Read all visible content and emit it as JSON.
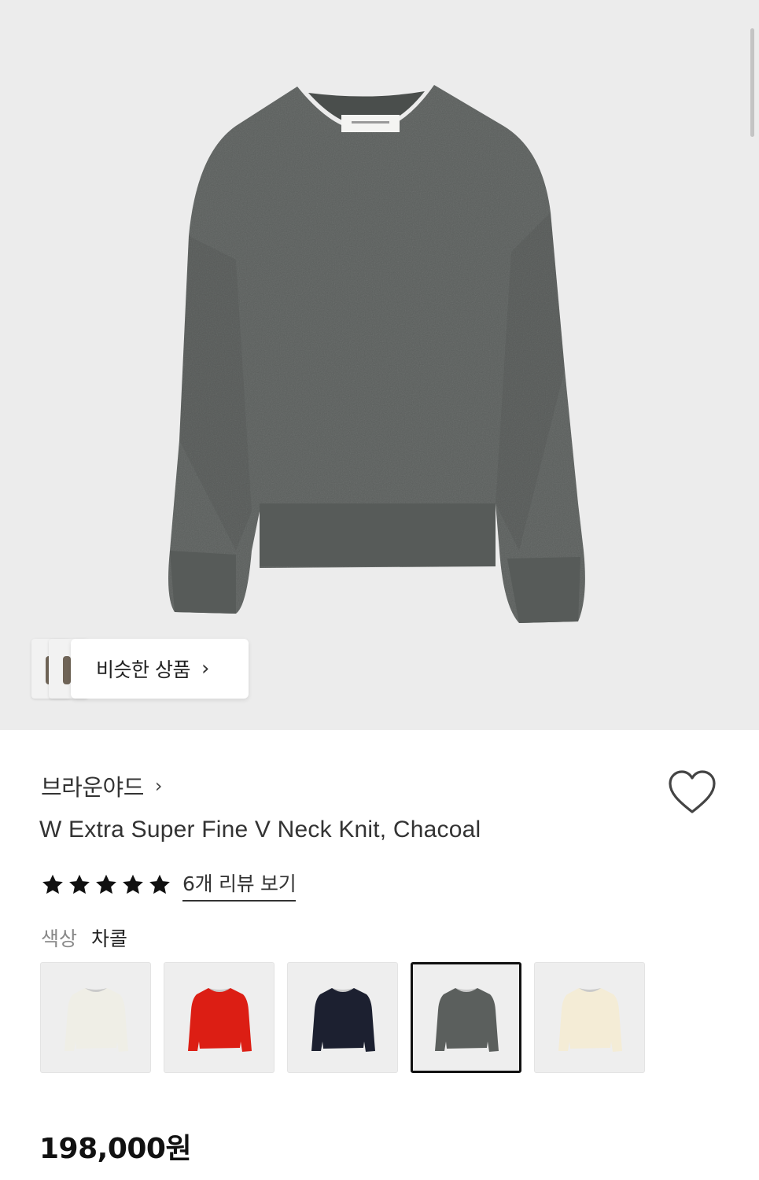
{
  "similar_products": {
    "label": "비슷한 상품",
    "chevron": "›"
  },
  "product": {
    "brand": "브라운야드",
    "brand_chevron": "›",
    "title": "W Extra Super Fine V Neck Knit, Chacoal",
    "rating_stars": 5,
    "review_link": "6개 리뷰 보기",
    "color_label": "색상",
    "color_value": "차콜",
    "price": "198,000원"
  },
  "color_options": [
    {
      "name": "ivory",
      "color": "#efeee6",
      "selected": false
    },
    {
      "name": "red",
      "color": "#dc1e14",
      "selected": false
    },
    {
      "name": "navy",
      "color": "#1c2030",
      "selected": false
    },
    {
      "name": "charcoal",
      "color": "#5b5f5d",
      "selected": true
    },
    {
      "name": "cream",
      "color": "#f4ecd6",
      "selected": false
    }
  ],
  "colors": {
    "hero_background": "#ececec",
    "sweater_main": "#5a5e5c",
    "star": "#111111"
  },
  "icons": [
    "heart-icon",
    "star-icon",
    "chevron-right-icon",
    "scrollbar"
  ]
}
